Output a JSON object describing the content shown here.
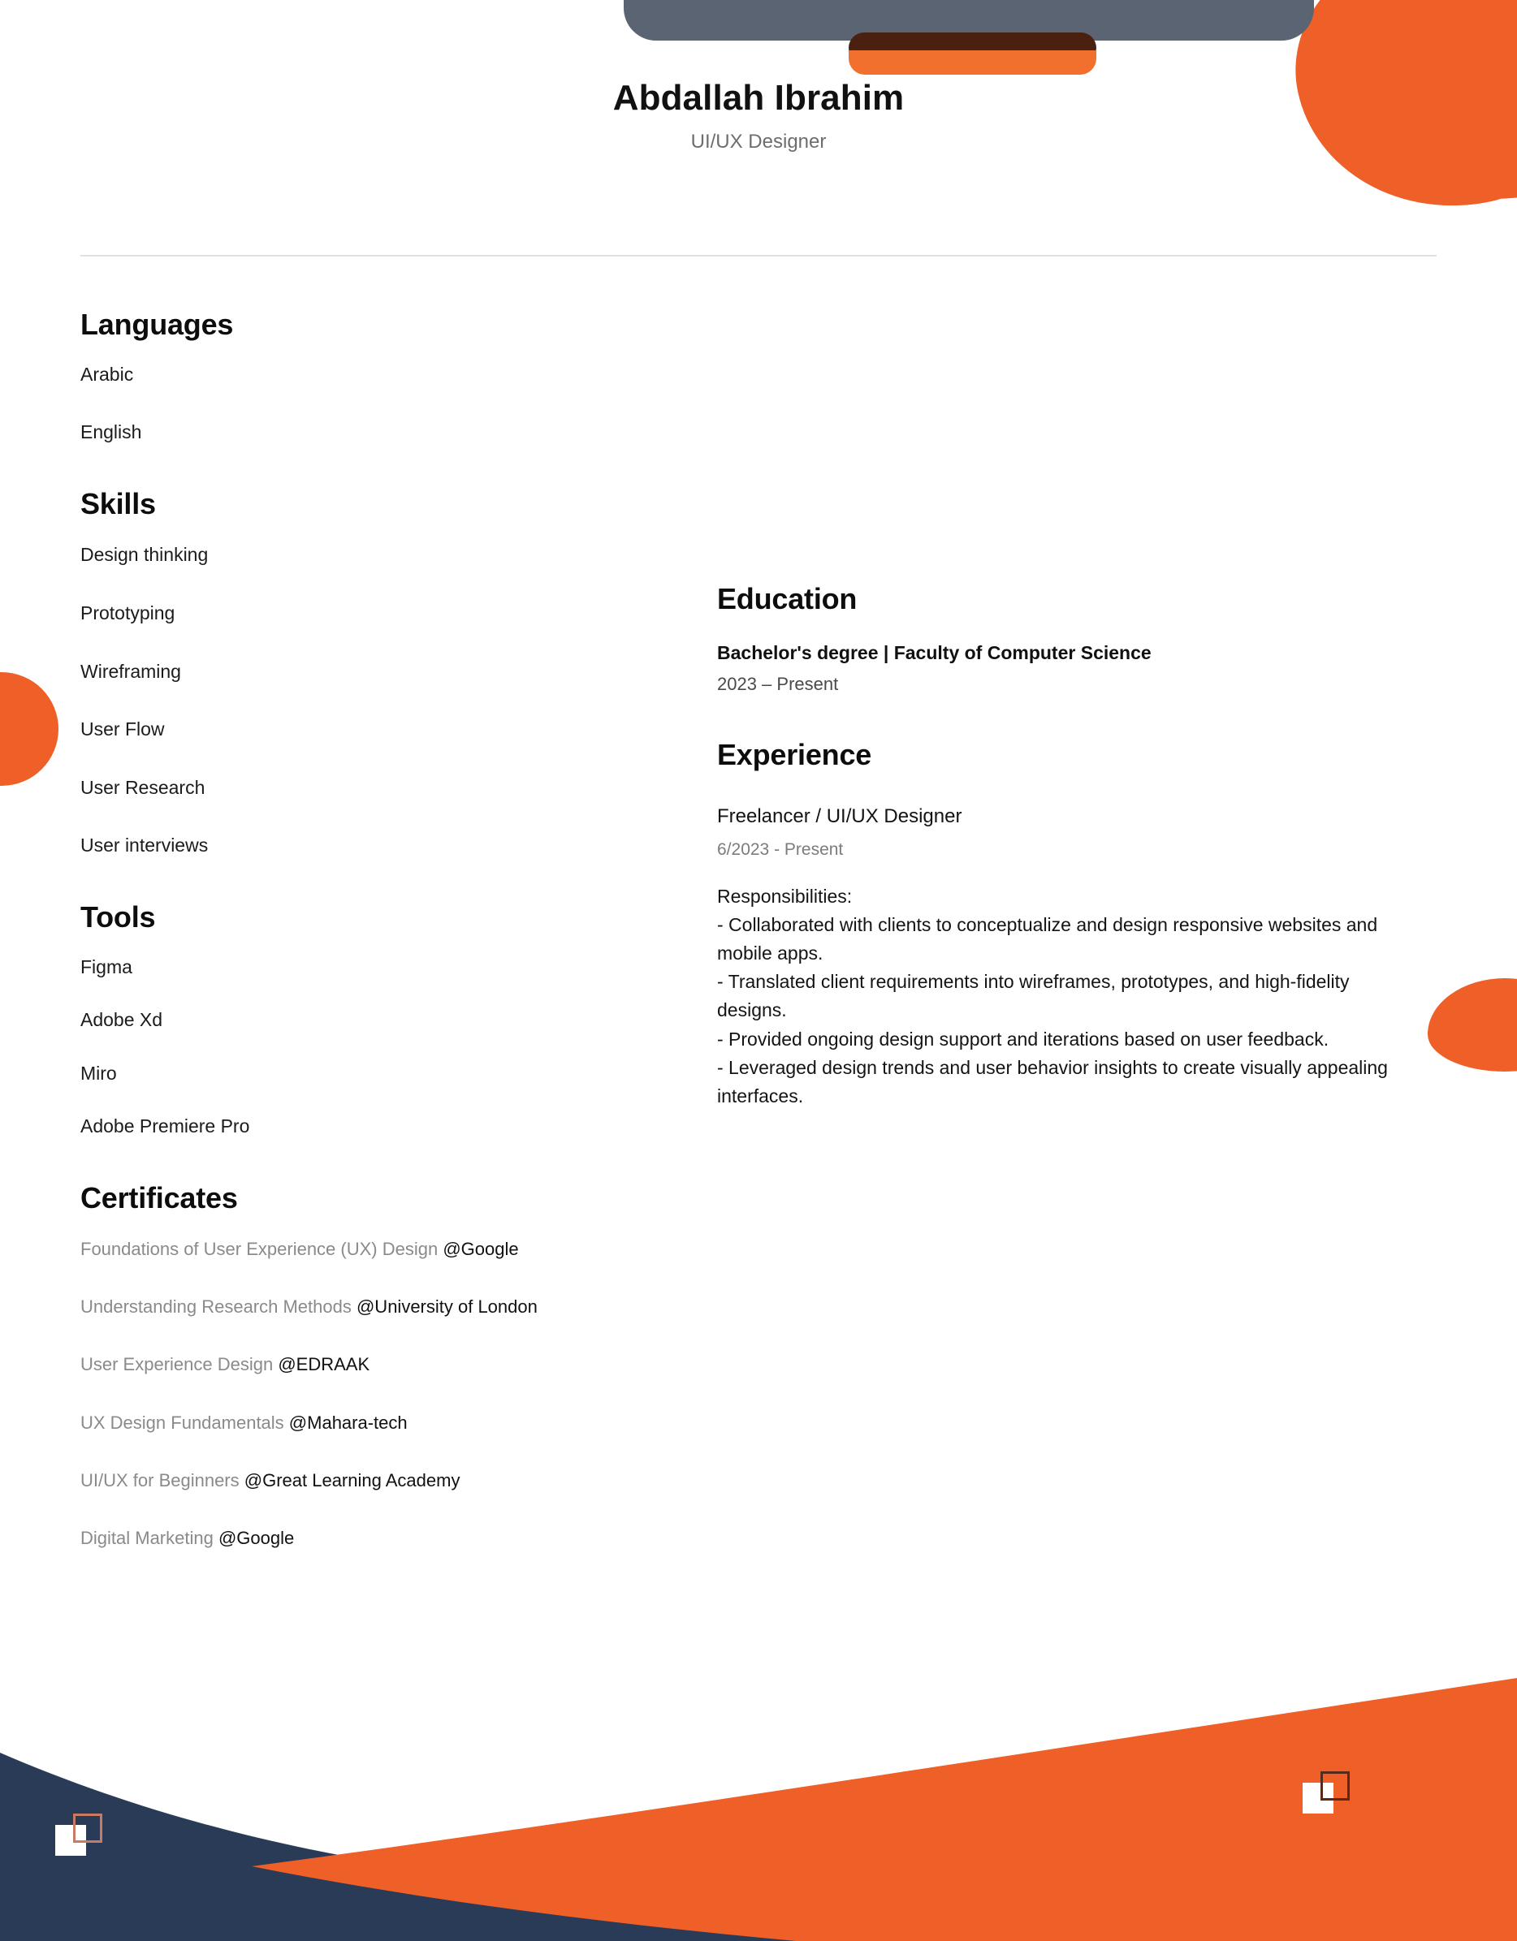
{
  "header": {
    "name": "Abdallah Ibrahim",
    "role": "UI/UX Designer"
  },
  "left_column": {
    "languages": {
      "title": "Languages",
      "items": [
        "Arabic",
        "English"
      ]
    },
    "skills": {
      "title": "Skills",
      "items": [
        "Design thinking",
        "Prototyping",
        "Wireframing",
        "User Flow",
        "User Research",
        "User interviews"
      ]
    },
    "tools": {
      "title": "Tools",
      "items": [
        "Figma",
        "Adobe Xd",
        "Miro",
        "Adobe Premiere Pro"
      ]
    },
    "certificates": {
      "title": "Certificates",
      "items": [
        {
          "name": "Foundations of User Experience (UX) Design ",
          "org": "@Google"
        },
        {
          "name": "Understanding Research Methods ",
          "org": "@University of London"
        },
        {
          "name": "User Experience Design ",
          "org": "@EDRAAK"
        },
        {
          "name": "UX Design Fundamentals ",
          "org": "@Mahara-tech"
        },
        {
          "name": "UI/UX for Beginners ",
          "org": "@Great Learning Academy"
        },
        {
          "name": "Digital Marketing ",
          "org": "@Google"
        }
      ]
    }
  },
  "right_column": {
    "education": {
      "title": "Education",
      "entries": [
        {
          "degree": " Bachelor's degree | Faculty of Computer Science",
          "dates": "2023 – Present"
        }
      ]
    },
    "experience": {
      "title": "Experience",
      "entries": [
        {
          "role": "Freelancer / UI/UX Designer",
          "dates": "6/2023 - Present",
          "body": "Responsibilities:\n- Collaborated with clients to conceptualize and design responsive websites and mobile apps.\n- Translated client requirements into wireframes, prototypes, and high-fidelity designs.\n- Provided ongoing design support and iterations based on user feedback.\n- Leveraged design trends and user behavior insights to create visually appealing interfaces."
        }
      ]
    }
  },
  "theme": {
    "accent_orange": "#ef5f28",
    "footer_navy": "#293b56",
    "avatar_grey": "#5a6472",
    "muted_text": "#8a8a8a",
    "divider": "#e0e0e0"
  }
}
